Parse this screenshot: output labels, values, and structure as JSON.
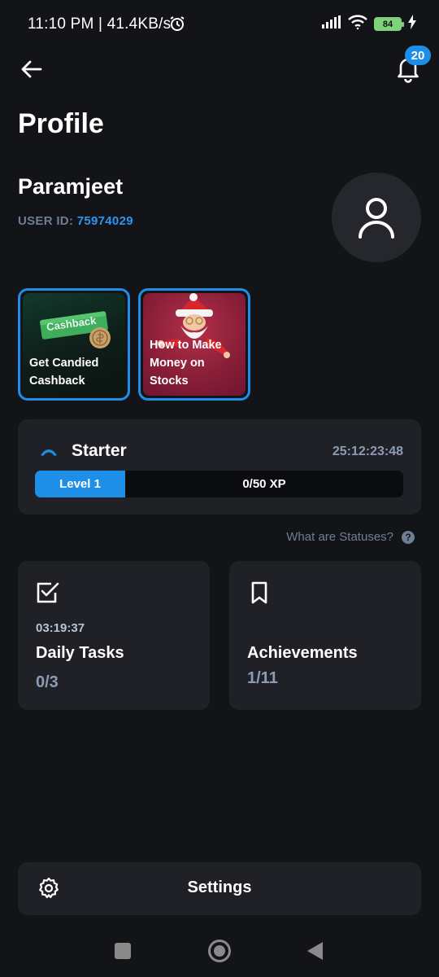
{
  "status_bar": {
    "time_network": "11:10 PM | 41.4KB/s",
    "battery": "84"
  },
  "header": {
    "notification_count": "20"
  },
  "page": {
    "title": "Profile"
  },
  "user": {
    "name": "Paramjeet",
    "id_label": "USER ID:",
    "id_value": "75974029"
  },
  "stories": [
    {
      "label_line1": "Get Candied",
      "label_line2": "Cashback",
      "badge_text": "Cashback"
    },
    {
      "label_line1": "How to Make",
      "label_line2": "Money on Stocks"
    }
  ],
  "level": {
    "name": "Starter",
    "timer": "25:12:23:48",
    "level_label": "Level 1",
    "xp_text": "0/50 XP",
    "xp_progress": 0
  },
  "statuses_link": "What are Statuses?",
  "tiles": {
    "tasks": {
      "timer": "03:19:37",
      "title": "Daily Tasks",
      "count": "0/3"
    },
    "achievements": {
      "title": "Achievements",
      "count": "1/11"
    }
  },
  "settings": {
    "label": "Settings"
  },
  "colors": {
    "background": "#131418",
    "card": "#1f2126",
    "accent": "#1e8fe8",
    "muted": "#6f7e93"
  },
  "icons": {
    "back": "arrow-left-icon",
    "bell": "bell-icon",
    "avatar": "user-icon",
    "level": "chevron-up-icon",
    "tasks": "checkbox-icon",
    "achievements": "bookmark-icon",
    "settings": "gear-icon",
    "help": "question-icon"
  }
}
